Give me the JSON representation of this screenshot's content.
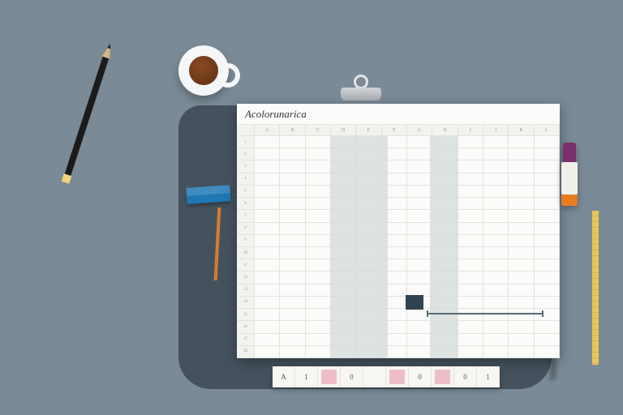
{
  "app": {
    "title": "Acolorunarica"
  },
  "columns": [
    "A",
    "B",
    "C",
    "D",
    "E",
    "F",
    "G",
    "H",
    "I",
    "J",
    "K",
    "L"
  ],
  "rows": [
    "1",
    "2",
    "3",
    "4",
    "5",
    "6",
    "7",
    "8",
    "9",
    "10",
    "11",
    "12",
    "13",
    "14",
    "15",
    "16",
    "17",
    "18"
  ],
  "tabs": [
    {
      "label": "A",
      "hl": false
    },
    {
      "label": "1",
      "hl": false
    },
    {
      "label": "",
      "hl": true
    },
    {
      "label": "0",
      "hl": false
    },
    {
      "label": "",
      "hl": false
    },
    {
      "label": "",
      "hl": true
    },
    {
      "label": "0",
      "hl": false
    },
    {
      "label": "",
      "hl": true
    },
    {
      "label": "0",
      "hl": false
    },
    {
      "label": "1",
      "hl": false
    }
  ],
  "icons": {
    "pencil": "pencil-icon",
    "coffee": "coffee-cup-icon",
    "eraser": "eraser-icon",
    "marker": "marker-icon",
    "ruler": "ruler-icon",
    "clip": "clipboard-clip-icon"
  }
}
